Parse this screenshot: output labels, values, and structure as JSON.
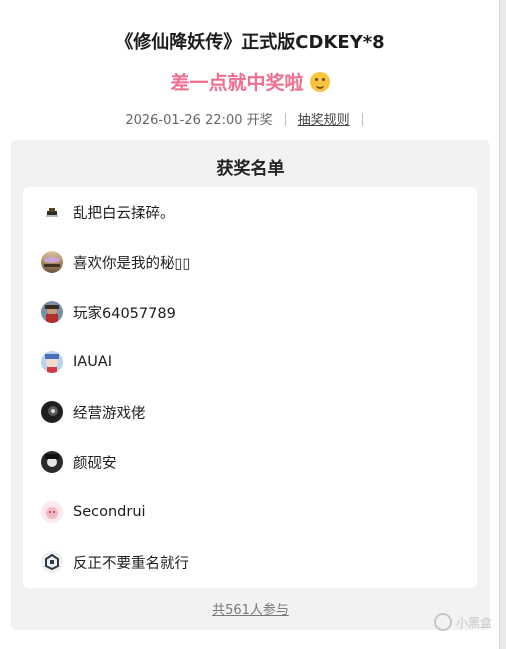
{
  "header": {
    "title": "《修仙降妖传》正式版CDKEY*8",
    "result_text": "差一点就中奖啦",
    "result_emoji": "thinking-face-icon",
    "draw_time": "2026-01-26 22:00 开奖",
    "rules_link": "抽奖规则"
  },
  "winners": {
    "title": "获奖名单",
    "items": [
      {
        "name": "乱把白云揉碎。",
        "avatar": "avatar-hat-icon"
      },
      {
        "name": "喜欢你是我的秘▯▯",
        "avatar": "avatar-landscape-icon"
      },
      {
        "name": "玩家64057789",
        "avatar": "avatar-portrait-icon"
      },
      {
        "name": "IAUAI",
        "avatar": "avatar-anime-icon"
      },
      {
        "name": "经营游戏佬",
        "avatar": "avatar-dark-icon"
      },
      {
        "name": "颜砚安",
        "avatar": "avatar-character-icon"
      },
      {
        "name": "Secondrui",
        "avatar": "avatar-pink-icon"
      },
      {
        "name": "反正不要重名就行",
        "avatar": "avatar-logo-icon"
      }
    ],
    "participants": "共561人参与"
  },
  "watermark": "小黑盒",
  "colors": {
    "accent": "#f06f8f",
    "panel": "#f2f2f2"
  }
}
